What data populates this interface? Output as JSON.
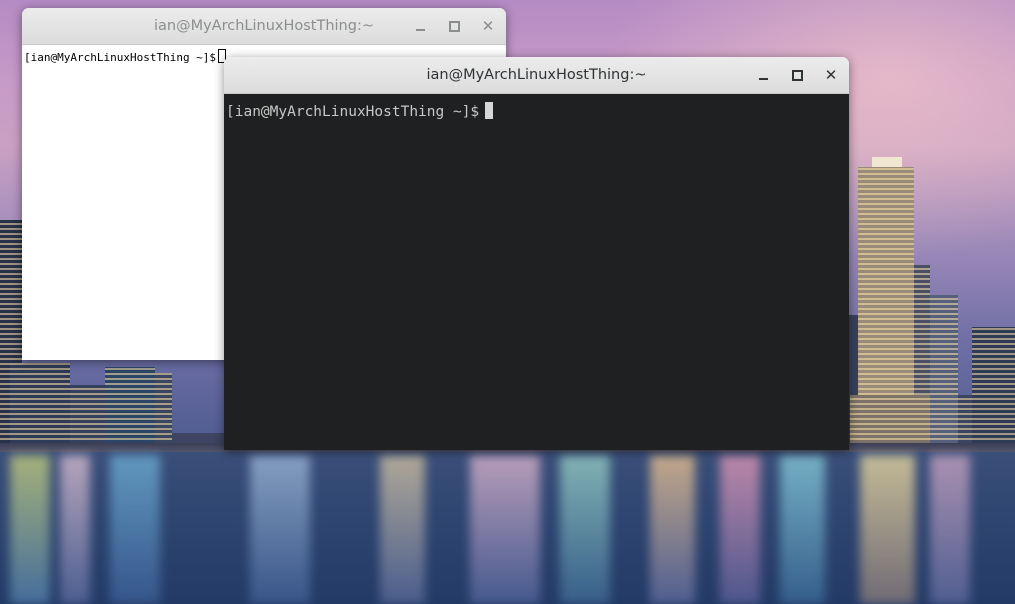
{
  "desktop": {
    "wallpaper": "city skyline at dusk over water"
  },
  "windows": [
    {
      "title": "ian@MyArchLinuxHostThing:~",
      "state": "inactive",
      "prompt": "[ian@MyArchLinuxHostThing ~]$",
      "controls": {
        "minimize": "minimize-icon",
        "maximize": "maximize-icon",
        "close": "close-icon"
      }
    },
    {
      "title": "ian@MyArchLinuxHostThing:~",
      "state": "active",
      "prompt": "[ian@MyArchLinuxHostThing ~]$",
      "controls": {
        "minimize": "minimize-icon",
        "maximize": "maximize-icon",
        "close": "close-icon"
      }
    }
  ],
  "colors": {
    "terminal_bg_dark": "#1f2021",
    "terminal_text_dark": "#c6c8c6",
    "terminal_bg_light": "#ffffff",
    "titlebar": "#e4e4e4"
  }
}
